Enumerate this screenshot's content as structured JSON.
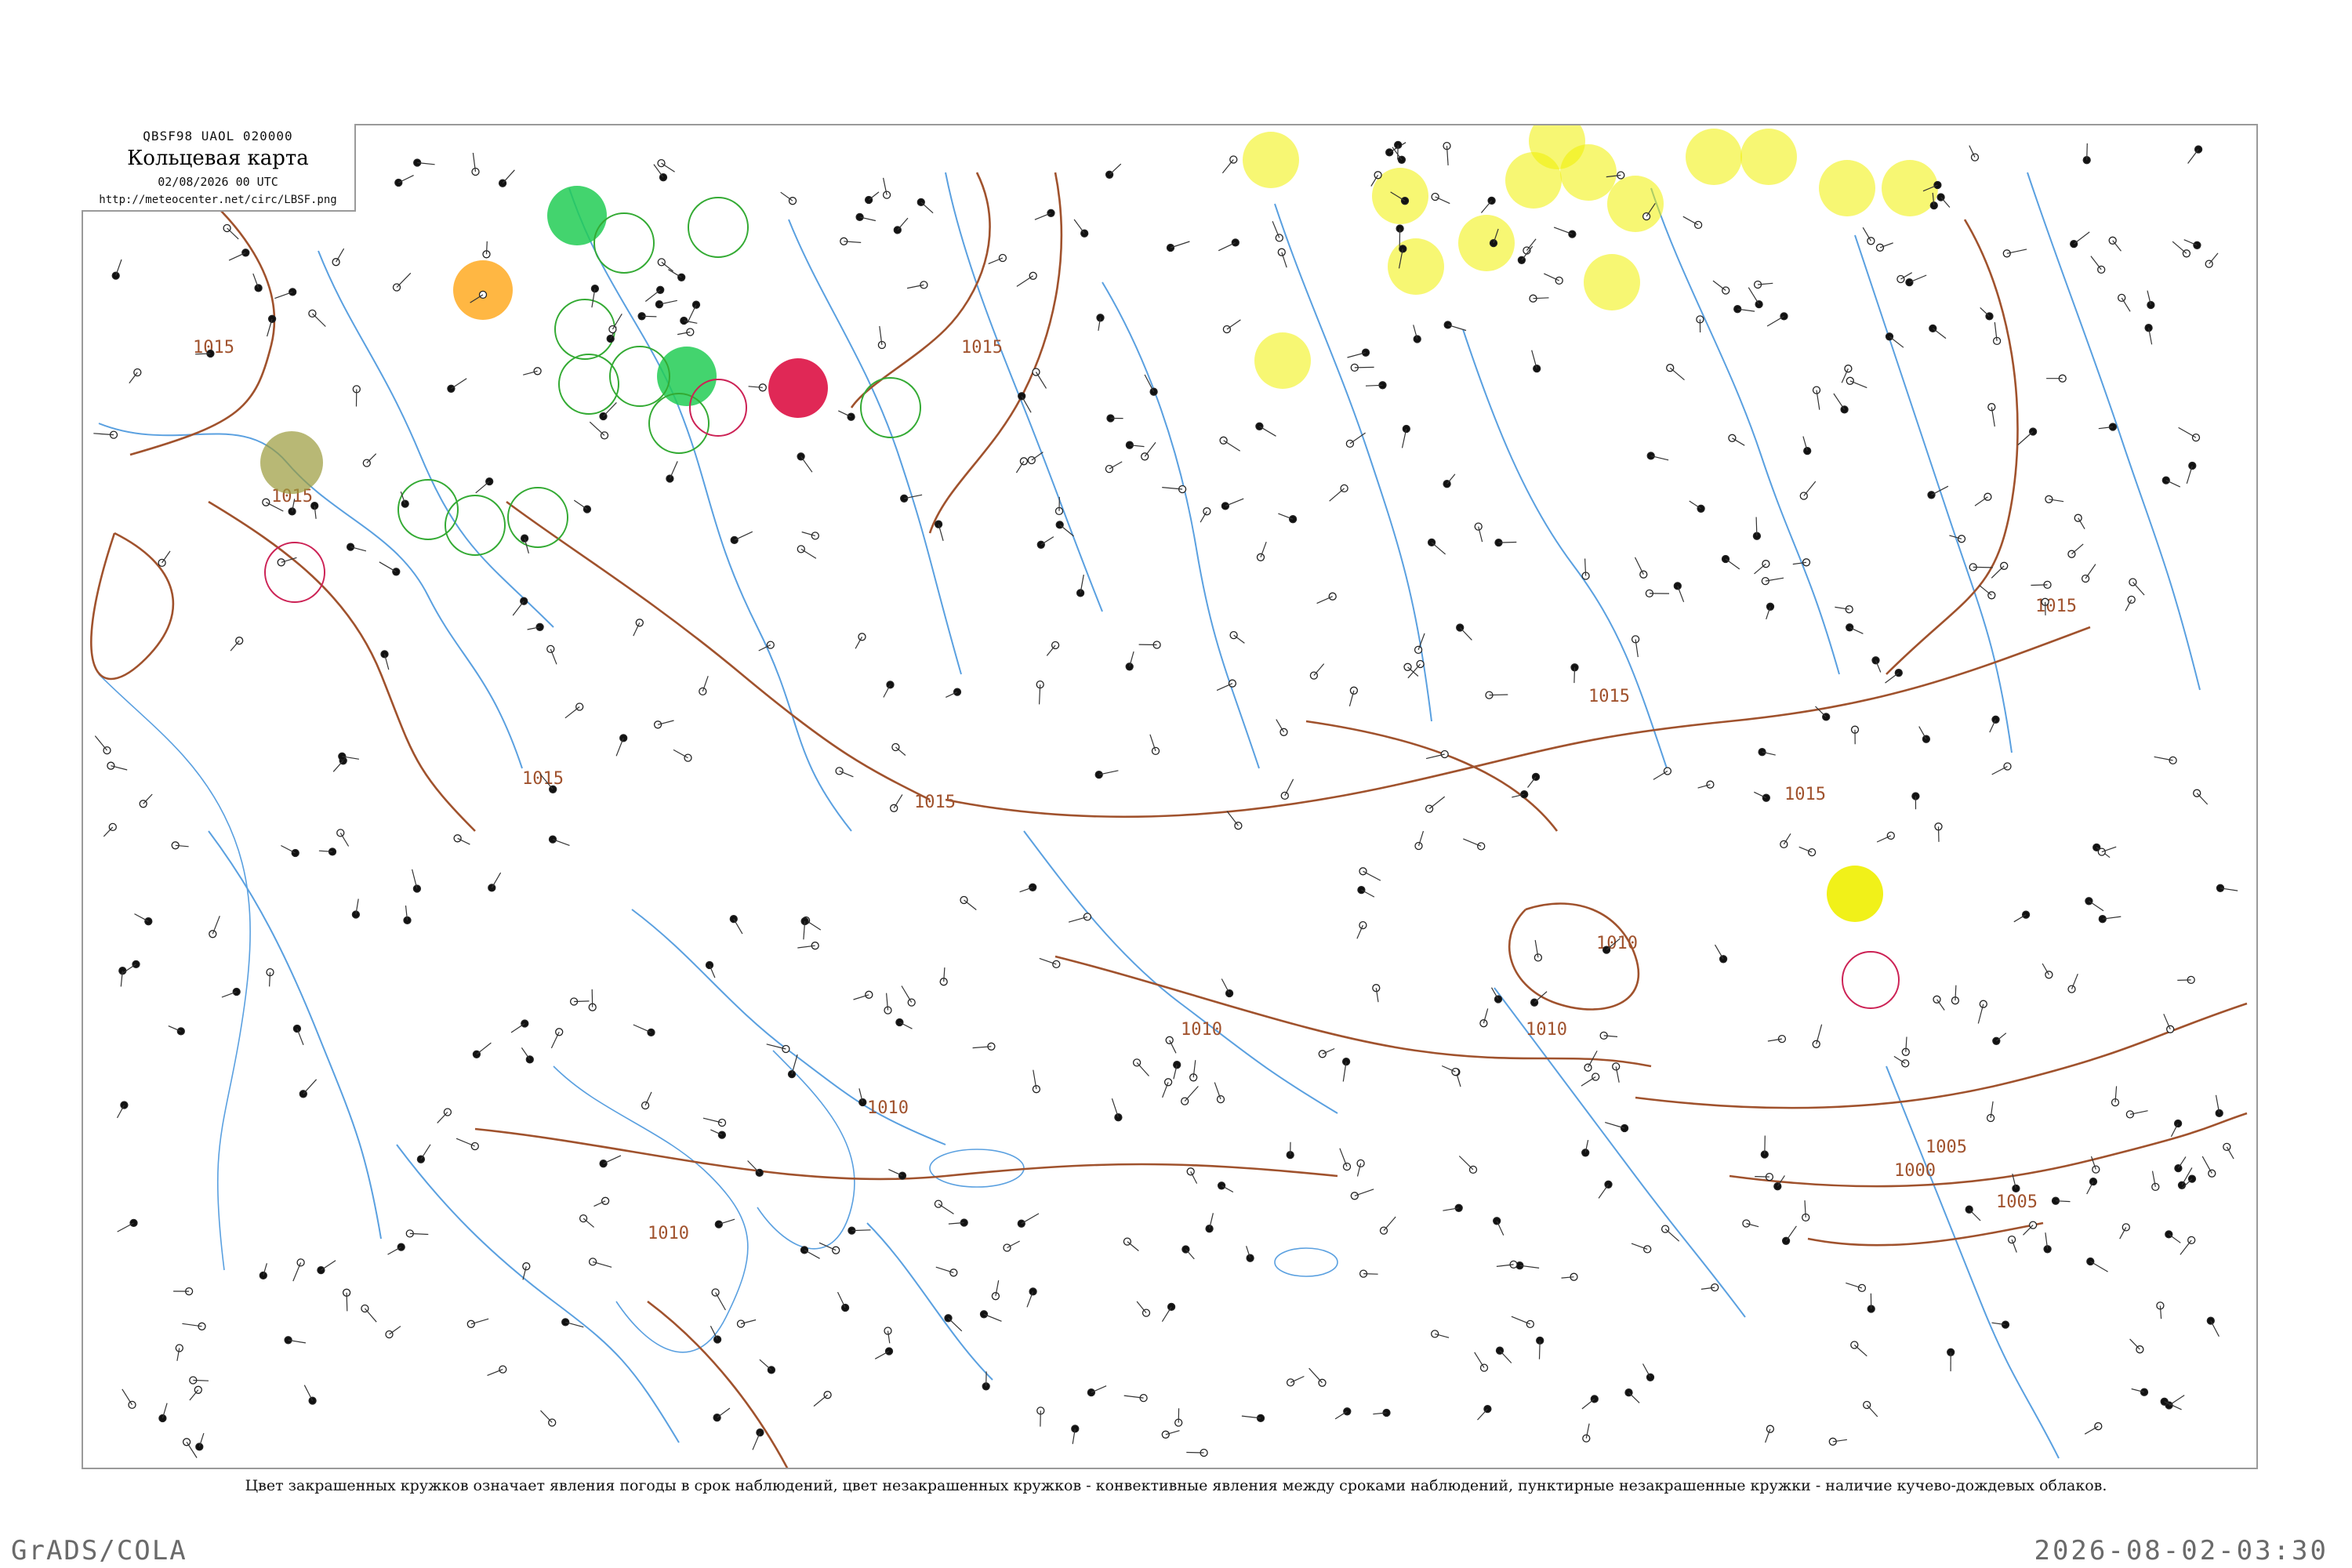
{
  "header": {
    "code": "QBSF98  UAOL  020000",
    "title": "Кольцевая карта",
    "date": "02/08/2026 00 UTC",
    "url": "http://meteocenter.net/circ/LBSF.png"
  },
  "footnote": "Цвет закрашенных кружков означает явления погоды в срок наблюдений, цвет незакрашенных кружков - конвективные явления между сроками наблюдений, пунктирные незакрашенные кружки - наличие кучево-дождевых облаков.",
  "brand": "GrADS/COLA",
  "timestamp": "2026-08-02-03:30",
  "isobars": [
    "1015",
    "1015",
    "1015",
    "1015",
    "1015",
    "1015",
    "1015",
    "1015",
    "1010",
    "1010",
    "1010",
    "1010",
    "1010",
    "1005",
    "1000",
    "1005"
  ],
  "colors": {
    "isobar": "#a0522d",
    "river": "#5aa0e0",
    "frame": "#9a9a9a",
    "station": "#222222",
    "rain": "#22cc55",
    "storm": "#dd1144",
    "fog": "#f0f000",
    "haze": "#ffaa22",
    "mist": "#9a9a3a",
    "convective_ring": "#33aa33",
    "cb_ring": "#cc2255"
  }
}
